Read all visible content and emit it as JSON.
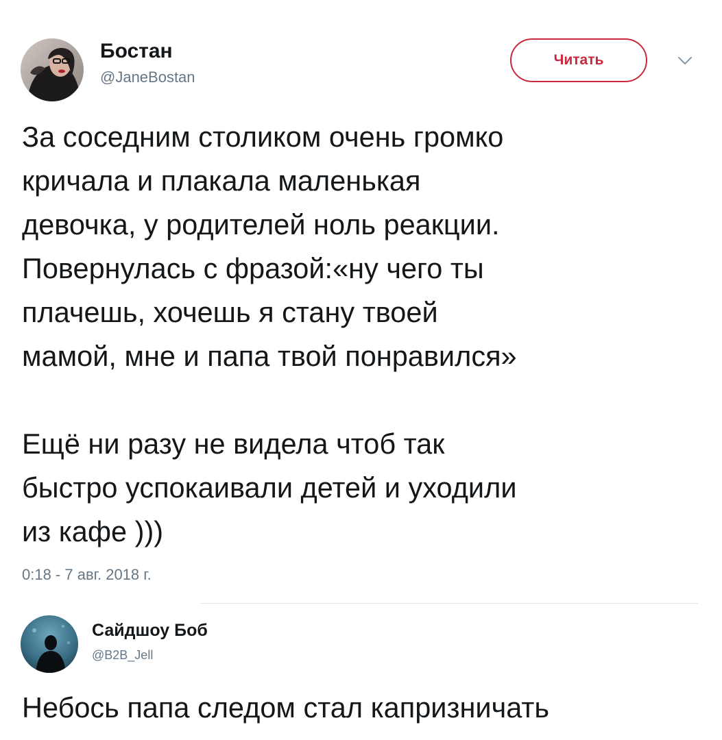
{
  "tweet": {
    "author": {
      "display_name": "Бостан",
      "handle": "@JaneBostan"
    },
    "follow_button_label": "Читать",
    "text_lines": [
      "За соседним столиком очень громко",
      "кричала и плакала маленькая",
      "девочка, у родителей ноль реакции.",
      "Повернулась с фразой:«ну чего ты",
      "плачешь, хочешь я стану твоей",
      "мамой, мне и папа твой понравился»",
      "",
      "Ещё ни разу не видела чтоб так",
      "быстро успокаивали детей  и уходили",
      "из кафе )))"
    ],
    "timestamp": "0:18 - 7 авг. 2018 г."
  },
  "reply": {
    "author": {
      "display_name": "Сайдшоу Боб",
      "handle": "@B2B_Jell"
    },
    "text": "Небось папа следом стал капризничать"
  },
  "colors": {
    "follow_accent": "#c8283c",
    "secondary_text": "#657786",
    "primary_text": "#14171a",
    "divider": "#e1e8ed"
  },
  "icons": {
    "menu_caret": "chevron-down-icon"
  }
}
